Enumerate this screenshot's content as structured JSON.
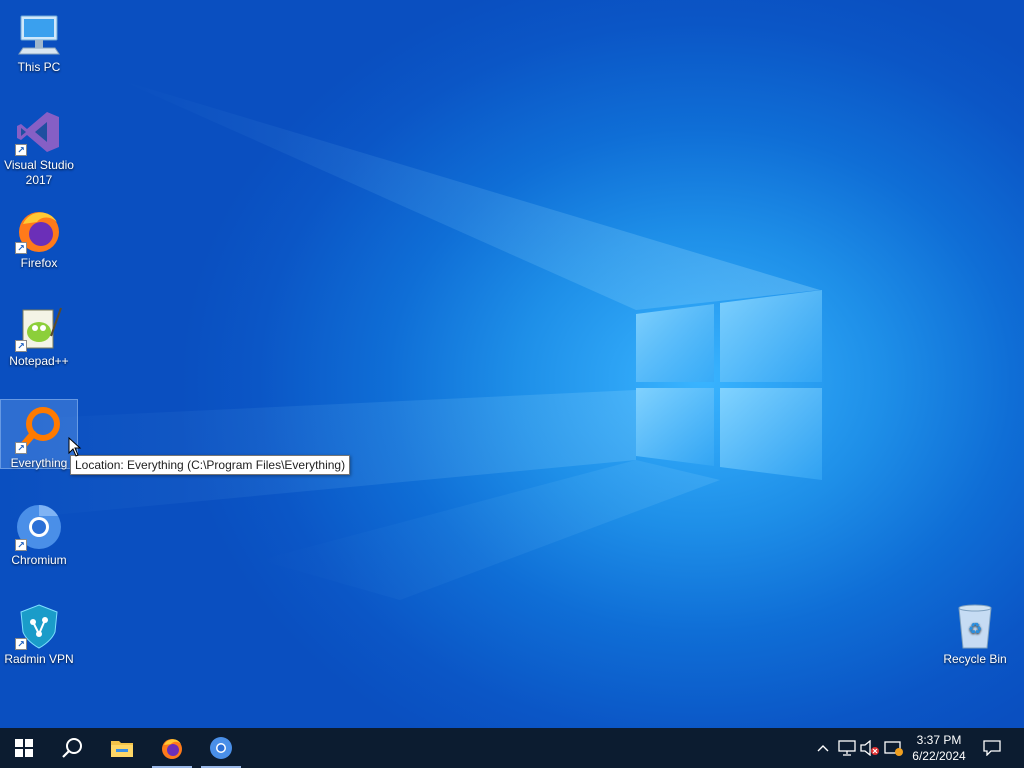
{
  "desktop": {
    "icons": [
      {
        "name": "This PC"
      },
      {
        "name": "Visual Studio 2017"
      },
      {
        "name": "Firefox"
      },
      {
        "name": "Notepad++"
      },
      {
        "name": "Everything"
      },
      {
        "name": "Chromium"
      },
      {
        "name": "Radmin VPN"
      },
      {
        "name": "Recycle Bin"
      }
    ],
    "tooltip": "Location: Everything (C:\\Program Files\\Everything)",
    "colors": {
      "background": "#0f6ed6",
      "accent": "#39b4ff",
      "taskbar": "#0c1c30"
    }
  },
  "taskbar": {
    "buttons": [
      "start-icon",
      "search-icon",
      "file-explorer-icon",
      "firefox-icon",
      "chromium-icon"
    ],
    "tray_icons": [
      "chevron-up-icon",
      "network-icon",
      "volume-muted-icon",
      "notification-icon"
    ],
    "clock": {
      "time": "3:37 PM",
      "date": "6/22/2024"
    }
  }
}
